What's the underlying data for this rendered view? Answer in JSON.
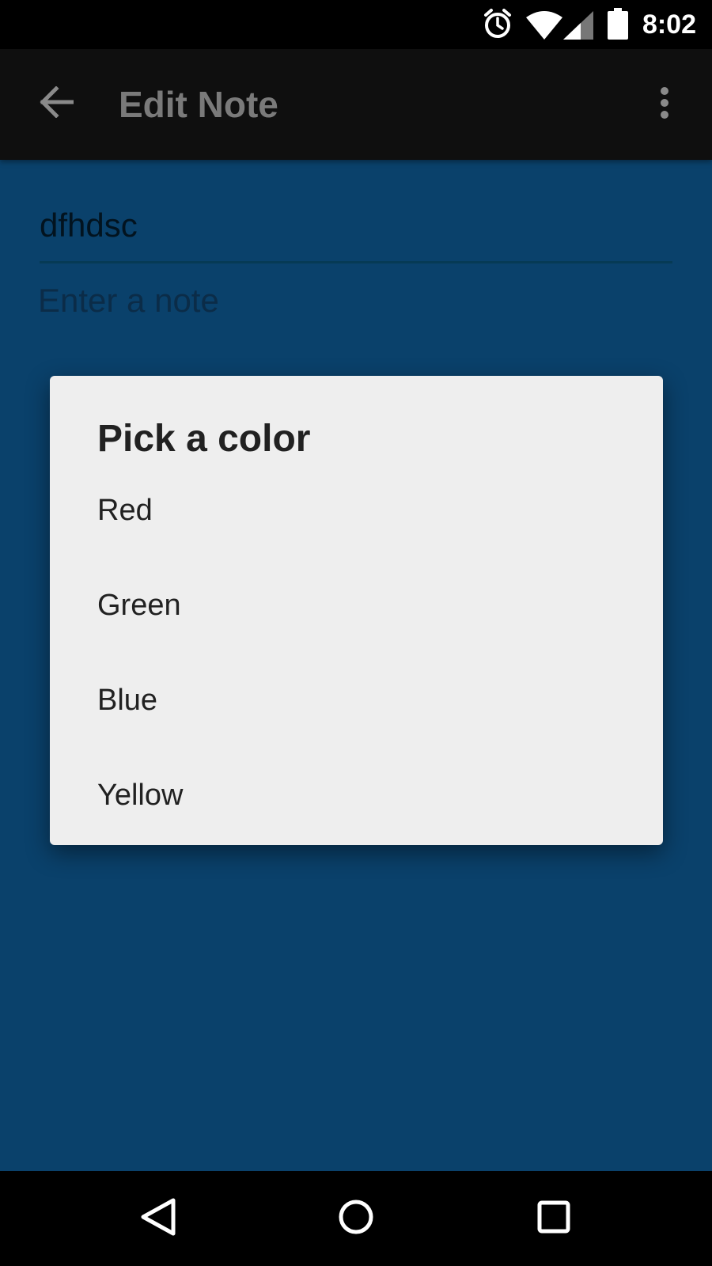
{
  "status_bar": {
    "time": "8:02",
    "icons": [
      "alarm-icon",
      "wifi-icon",
      "signal-icon",
      "battery-icon"
    ]
  },
  "app_bar": {
    "title": "Edit Note",
    "back_icon": "arrow-left-icon",
    "menu_icon": "more-vert-icon"
  },
  "note": {
    "title_value": "dfhdsc",
    "body_placeholder": "Enter a note"
  },
  "dialog": {
    "title": "Pick a color",
    "options": [
      "Red",
      "Green",
      "Blue",
      "Yellow"
    ]
  },
  "nav_bar": {
    "icons": [
      "back-triangle-icon",
      "home-circle-icon",
      "recents-square-icon"
    ]
  },
  "colors": {
    "background": "#0a416b",
    "app_bar": "#0f0f0f",
    "dialog": "#eeeeee"
  }
}
